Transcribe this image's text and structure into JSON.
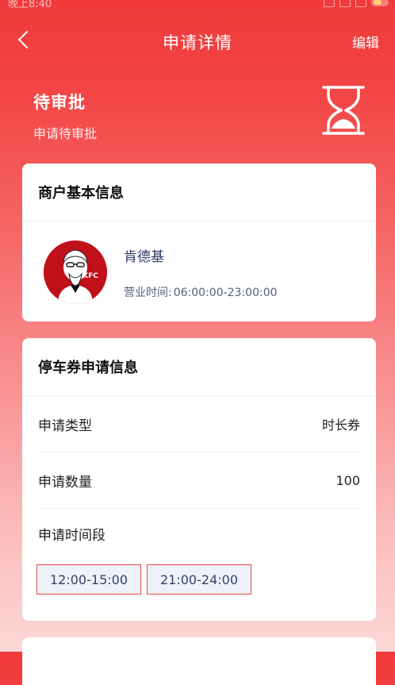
{
  "status_bar": {
    "time": "晚上8:40"
  },
  "nav": {
    "title": "申请详情",
    "edit": "编辑"
  },
  "status": {
    "title": "待审批",
    "subtitle": "申请待审批"
  },
  "merchant": {
    "section_title": "商户基本信息",
    "name": "肯德基",
    "hours_label": "营业时间:",
    "hours_value": "06:00:00-23:00:00",
    "logo_text": "KFC"
  },
  "application": {
    "section_title": "停车券申请信息",
    "type_label": "申请类型",
    "type_value": "时长券",
    "qty_label": "申请数量",
    "qty_value": "100",
    "period_label": "申请时间段",
    "time_slots": [
      "12:00-15:00",
      "21:00-24:00"
    ]
  },
  "colors": {
    "brand_red": "#f0393a",
    "slot_border": "#e74a4a"
  }
}
